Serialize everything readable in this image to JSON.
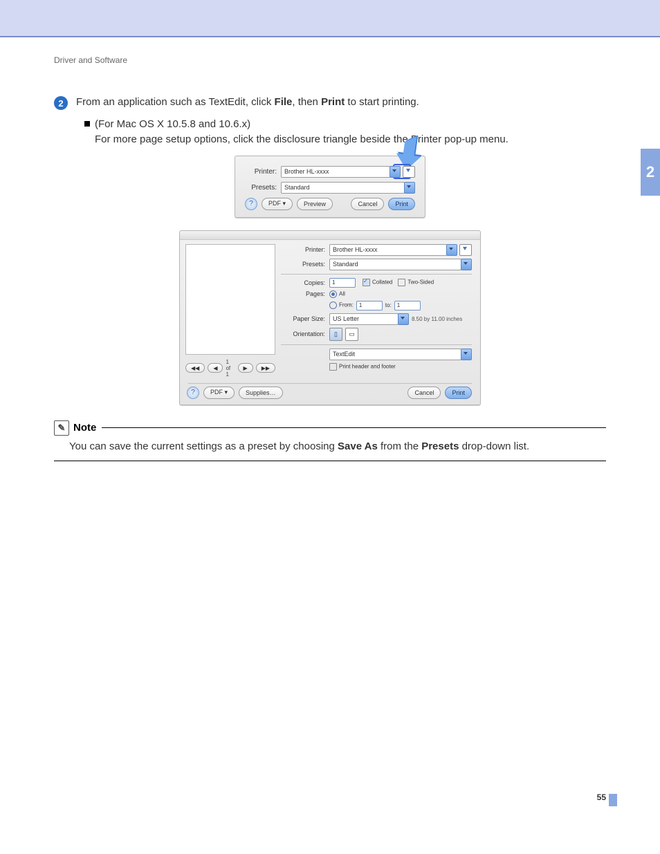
{
  "header": {
    "running": "Driver and Software"
  },
  "chapter": "2",
  "step": {
    "num": "2",
    "text_pre": "From an application such as TextEdit, click ",
    "text_b1": "File",
    "text_mid": ", then ",
    "text_b2": "Print",
    "text_post": " to start printing."
  },
  "sub": {
    "paren": "(For Mac OS X 10.5.8 and 10.6.x)",
    "body": "For more page setup options, click the disclosure triangle beside the Printer pop-up menu."
  },
  "dlg_small": {
    "printer_lbl": "Printer:",
    "presets_lbl": "Presets:",
    "printer_val": "Brother HL-xxxx",
    "presets_val": "Standard",
    "pdf": "PDF ▾",
    "preview": "Preview",
    "cancel": "Cancel",
    "print": "Print"
  },
  "dlg_large": {
    "printer_lbl": "Printer:",
    "presets_lbl": "Presets:",
    "printer_val": "Brother HL-xxxx",
    "presets_val": "Standard",
    "copies_lbl": "Copies:",
    "copies_val": "1",
    "collated": "Collated",
    "twosided": "Two-Sided",
    "pages_lbl": "Pages:",
    "all": "All",
    "from": "From:",
    "from_val": "1",
    "to": "to:",
    "to_val": "1",
    "psize_lbl": "Paper Size:",
    "psize_val": "US Letter",
    "psize_dim": "8.50 by 11.00 inches",
    "orient_lbl": "Orientation:",
    "app_popup": "TextEdit",
    "hdrftr": "Print header and footer",
    "pager": "1 of 1",
    "pdf": "PDF ▾",
    "supplies": "Supplies…",
    "cancel": "Cancel",
    "print": "Print"
  },
  "note": {
    "title": "Note",
    "body_pre": "You can save the current settings as a preset by choosing ",
    "body_b1": "Save As",
    "body_mid": " from the ",
    "body_b2": "Presets",
    "body_post": " drop-down list."
  },
  "page_number": "55"
}
